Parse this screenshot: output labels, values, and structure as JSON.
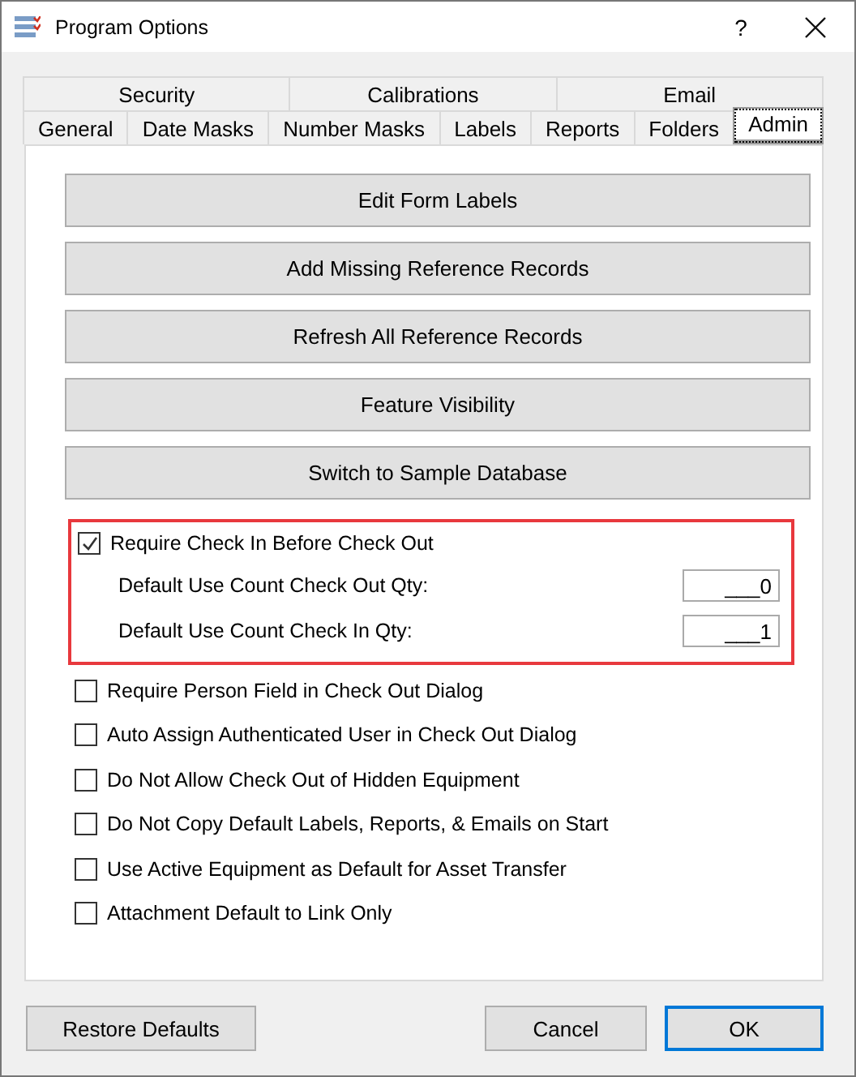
{
  "window": {
    "title": "Program Options",
    "help": "?"
  },
  "tab_rows": [
    [
      {
        "label": "Security",
        "selected": false
      },
      {
        "label": "Calibrations",
        "selected": false
      },
      {
        "label": "Email",
        "selected": false
      }
    ],
    [
      {
        "label": "General",
        "selected": false
      },
      {
        "label": "Date Masks",
        "selected": false
      },
      {
        "label": "Number Masks",
        "selected": false
      },
      {
        "label": "Labels",
        "selected": false
      },
      {
        "label": "Reports",
        "selected": false
      },
      {
        "label": "Folders",
        "selected": false
      },
      {
        "label": "Admin",
        "selected": true
      }
    ]
  ],
  "actions": [
    "Edit Form Labels",
    "Add Missing Reference Records",
    "Refresh All Reference Records",
    "Feature Visibility",
    "Switch to Sample Database"
  ],
  "check_in_group": {
    "highlighted": true,
    "label": "Require Check In Before Check Out",
    "checked": true,
    "fields": [
      {
        "label": "Default Use Count Check Out Qty:",
        "value": "___0"
      },
      {
        "label": "Default Use Count Check In Qty:",
        "value": "___1"
      }
    ]
  },
  "options": [
    {
      "label": "Require Person Field in Check Out Dialog",
      "checked": false
    },
    {
      "label": "Auto Assign Authenticated User in Check Out Dialog",
      "checked": false
    },
    {
      "label": "Do Not Allow Check Out of Hidden Equipment",
      "checked": false
    },
    {
      "label": "Do Not Copy Default Labels, Reports, & Emails on Start",
      "checked": false
    },
    {
      "label": "Use Active Equipment as Default for Asset Transfer",
      "checked": false
    },
    {
      "label": "Attachment Default to Link Only",
      "checked": false
    }
  ],
  "footer": {
    "left": [
      {
        "label": "Restore Defaults",
        "default": false
      }
    ],
    "right": [
      {
        "label": "Cancel",
        "default": false
      },
      {
        "label": "OK",
        "default": true
      }
    ]
  }
}
